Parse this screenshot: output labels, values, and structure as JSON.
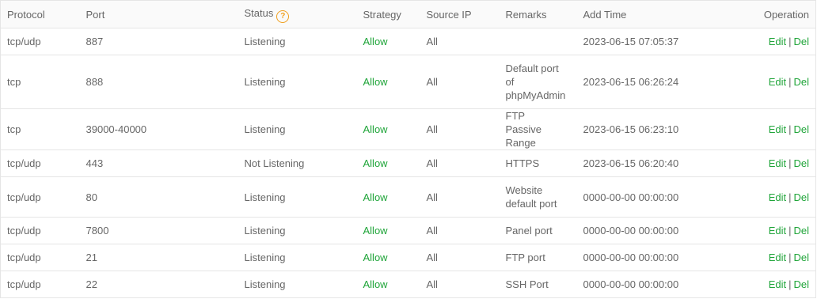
{
  "headers": {
    "protocol": "Protocol",
    "port": "Port",
    "status": "Status",
    "status_help": "?",
    "strategy": "Strategy",
    "source_ip": "Source IP",
    "remarks": "Remarks",
    "add_time": "Add Time",
    "operation": "Operation"
  },
  "actions": {
    "edit": "Edit",
    "separator": "|",
    "del": "Del"
  },
  "colors": {
    "accent": "#20a53a",
    "help": "#f0a020",
    "border": "#e5e5e5"
  },
  "rows": [
    {
      "protocol": "tcp/udp",
      "port": "887",
      "status": "Listening",
      "strategy": "Allow",
      "source_ip": "All",
      "remarks": "",
      "add_time": "2023-06-15 07:05:37"
    },
    {
      "protocol": "tcp",
      "port": "888",
      "status": "Listening",
      "strategy": "Allow",
      "source_ip": "All",
      "remarks": "Default port of phpMyAdmin",
      "add_time": "2023-06-15 06:26:24"
    },
    {
      "protocol": "tcp",
      "port": "39000-40000",
      "status": "Listening",
      "strategy": "Allow",
      "source_ip": "All",
      "remarks": "FTP Passive Range",
      "add_time": "2023-06-15 06:23:10"
    },
    {
      "protocol": "tcp/udp",
      "port": "443",
      "status": "Not Listening",
      "strategy": "Allow",
      "source_ip": "All",
      "remarks": "HTTPS",
      "add_time": "2023-06-15 06:20:40"
    },
    {
      "protocol": "tcp/udp",
      "port": "80",
      "status": "Listening",
      "strategy": "Allow",
      "source_ip": "All",
      "remarks": "Website default port",
      "add_time": "0000-00-00 00:00:00"
    },
    {
      "protocol": "tcp/udp",
      "port": "7800",
      "status": "Listening",
      "strategy": "Allow",
      "source_ip": "All",
      "remarks": "Panel port",
      "add_time": "0000-00-00 00:00:00"
    },
    {
      "protocol": "tcp/udp",
      "port": "21",
      "status": "Listening",
      "strategy": "Allow",
      "source_ip": "All",
      "remarks": "FTP port",
      "add_time": "0000-00-00 00:00:00"
    },
    {
      "protocol": "tcp/udp",
      "port": "22",
      "status": "Listening",
      "strategy": "Allow",
      "source_ip": "All",
      "remarks": "SSH Port",
      "add_time": "0000-00-00 00:00:00"
    }
  ]
}
